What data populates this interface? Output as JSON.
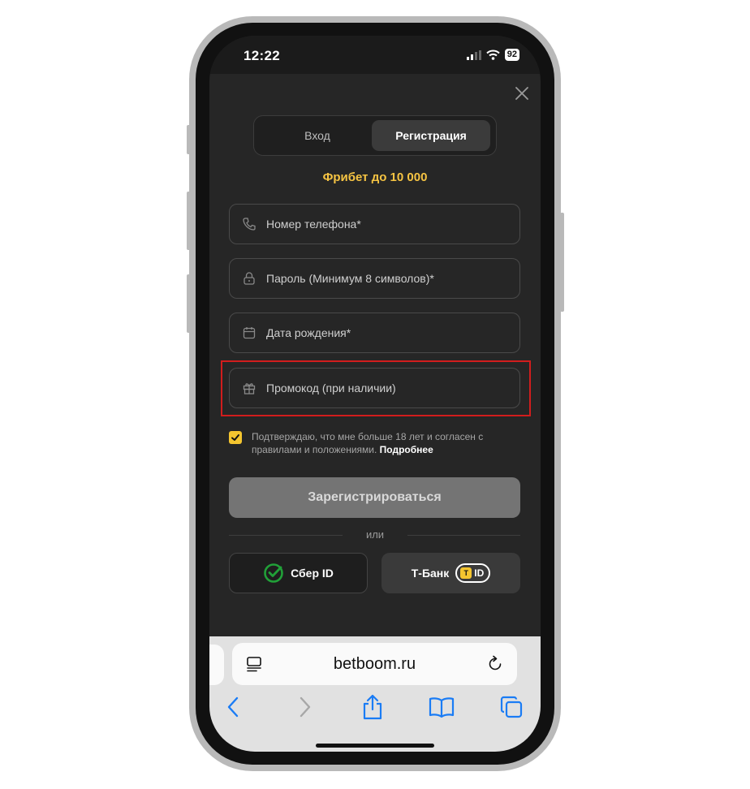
{
  "status": {
    "time": "12:22",
    "battery": "92"
  },
  "tabs": {
    "login": "Вход",
    "register": "Регистрация"
  },
  "bonus": "Фрибет до 10 000",
  "fields": {
    "phone": "Номер телефона*",
    "password": "Пароль (Минимум 8 символов)*",
    "birthdate": "Дата рождения*",
    "promo": "Промокод (при наличии)"
  },
  "agreement": {
    "text": "Подтверждаю, что мне больше 18 лет и согласен с правилами и положениями.",
    "link": "Подробнее",
    "checked": true
  },
  "submit_label": "Зарегистрироваться",
  "or_label": "или",
  "social": {
    "sber": "Сбер ID",
    "tbank": "Т-Банк",
    "tbank_badge": "ID"
  },
  "browser": {
    "url": "betboom.ru"
  },
  "colors": {
    "accent": "#f6c443",
    "highlight": "#d11d1d",
    "browser_blue": "#1a7cf5"
  }
}
